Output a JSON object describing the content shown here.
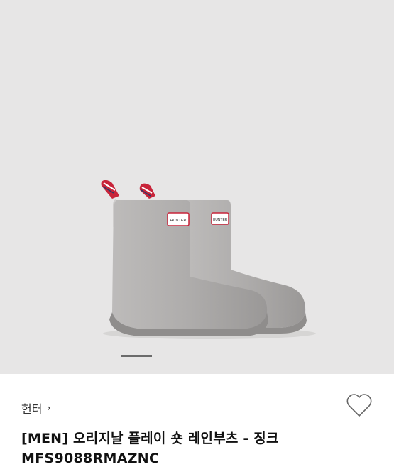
{
  "product": {
    "brand": "헌터",
    "brand_chevron": "›",
    "title": "[MEN] 오리지날 플레이 숏 레인부츠 - 징크",
    "model_code": "MFS9088RMAZNC",
    "boot_logo": "HUNTER"
  },
  "gallery": {
    "image_icon": "rain-boots-image",
    "pager_active": 1
  },
  "icons": {
    "wishlist": "heart-outline-icon"
  },
  "colors": {
    "hero_bg": "#e7e6e6",
    "boot": "#a9a7a6",
    "pager": "#6b6b6b"
  }
}
